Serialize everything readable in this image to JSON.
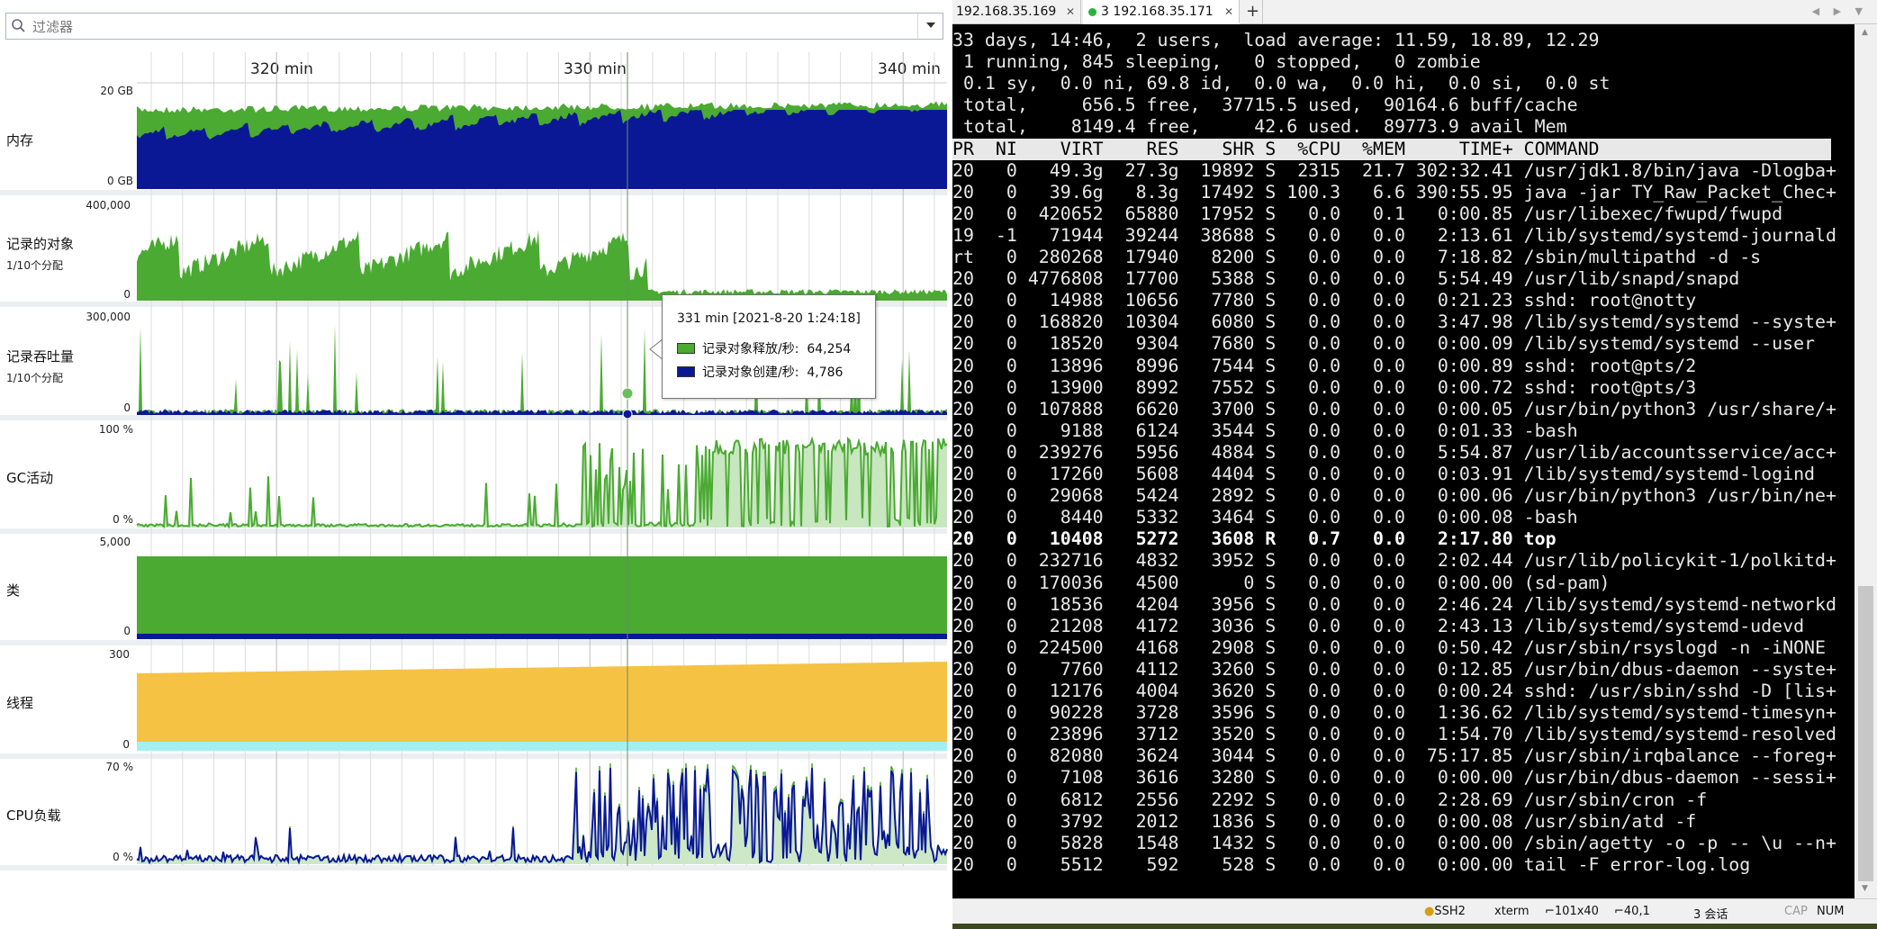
{
  "filter": {
    "placeholder": "过滤器",
    "search_icon": "search-icon",
    "dropdown_icon": "chevron-down-icon"
  },
  "timeline": {
    "labels": [
      "320 min",
      "330 min",
      "340 min"
    ],
    "cursor_label": "331 min"
  },
  "rows": {
    "memory": {
      "label": "内存",
      "y_top": "20 GB",
      "y_bottom": "0 GB"
    },
    "objects": {
      "label": "记录的对象",
      "sublabel": "1/10个分配",
      "y_top": "400,000",
      "y_bottom": "0"
    },
    "throughput": {
      "label": "记录吞吐量",
      "sublabel": "1/10个分配",
      "y_top": "300,000",
      "y_bottom": "0"
    },
    "gc": {
      "label": "GC活动",
      "y_top": "100 %",
      "y_bottom": "0 %"
    },
    "classes": {
      "label": "类",
      "y_top": "5,000",
      "y_bottom": "0"
    },
    "threads": {
      "label": "线程",
      "y_top": "300",
      "y_bottom": "0"
    },
    "cpu": {
      "label": "CPU负载",
      "y_top": "70 %",
      "y_bottom": "0 %"
    }
  },
  "tooltip": {
    "title": "331 min [2021-8-20 1:24:18]",
    "rows": [
      {
        "label": "记录对象释放/秒:",
        "value": "64,254",
        "color": "#4aaa32"
      },
      {
        "label": "记录对象创建/秒:",
        "value": "4,786",
        "color": "#0a1896"
      }
    ]
  },
  "colors": {
    "green": "#4aaa32",
    "navy": "#0a1896",
    "yellow": "#f5c244",
    "cyan": "#a3f0ee"
  },
  "terminal": {
    "tabs": [
      {
        "label": "192.168.35.169"
      },
      {
        "label": "3 192.168.35.171"
      }
    ],
    "tab_add": "+",
    "tab_nav": "◀ ▶ ▼",
    "summary": [
      "33 days, 14:46,  2 users,  load average: 11.59, 18.89, 12.29",
      " 1 running, 845 sleeping,   0 stopped,   0 zombie",
      " 0.1 sy,  0.0 ni, 69.8 id,  0.0 wa,  0.0 hi,  0.0 si,  0.0 st",
      " total,     656.5 free,  37715.5 used,  90164.6 buff/cache",
      " total,    8149.4 free,     42.6 used.  89773.9 avail Mem"
    ],
    "header": "PR  NI    VIRT    RES    SHR S  %CPU  %MEM     TIME+ COMMAND",
    "processes": [
      "20   0   49.3g  27.3g  19892 S  2315  21.7 302:32.41 /usr/jdk1.8/bin/java -Dlogba+",
      "20   0   39.6g   8.3g  17492 S 100.3   6.6 390:55.95 java -jar TY_Raw_Packet_Chec+",
      "20   0  420652  65880  17952 S   0.0   0.1   0:00.85 /usr/libexec/fwupd/fwupd",
      "19  -1   71944  39244  38688 S   0.0   0.0   2:13.61 /lib/systemd/systemd-journald",
      "rt   0  280268  17940   8200 S   0.0   0.0   7:18.82 /sbin/multipathd -d -s",
      "20   0 4776808  17700   5388 S   0.0   0.0   5:54.49 /usr/lib/snapd/snapd",
      "20   0   14988  10656   7780 S   0.0   0.0   0:21.23 sshd: root@notty",
      "20   0  168820  10304   6080 S   0.0   0.0   3:47.98 /lib/systemd/systemd --syste+",
      "20   0   18520   9304   7680 S   0.0   0.0   0:00.09 /lib/systemd/systemd --user",
      "20   0   13896   8996   7544 S   0.0   0.0   0:00.89 sshd: root@pts/2",
      "20   0   13900   8992   7552 S   0.0   0.0   0:00.72 sshd: root@pts/3",
      "20   0  107888   6620   3700 S   0.0   0.0   0:00.05 /usr/bin/python3 /usr/share/+",
      "20   0    9188   6124   3544 S   0.0   0.0   0:01.33 -bash",
      "20   0  239276   5956   4884 S   0.0   0.0   5:54.87 /usr/lib/accountsservice/acc+",
      "20   0   17260   5608   4404 S   0.0   0.0   0:03.91 /lib/systemd/systemd-logind",
      "20   0   29068   5424   2892 S   0.0   0.0   0:00.06 /usr/bin/python3 /usr/bin/ne+",
      "20   0    8440   5332   3464 S   0.0   0.0   0:00.08 -bash",
      "20   0   10408   5272   3608 R   0.7   0.0   2:17.80 top",
      "20   0  232716   4832   3952 S   0.0   0.0   2:02.44 /usr/lib/policykit-1/polkitd+",
      "20   0  170036   4500      0 S   0.0   0.0   0:00.00 (sd-pam)",
      "20   0   18536   4204   3956 S   0.0   0.0   2:46.24 /lib/systemd/systemd-networkd",
      "20   0   21208   4172   3036 S   0.0   0.0   2:43.13 /lib/systemd/systemd-udevd",
      "20   0  224500   4168   2908 S   0.0   0.0   0:50.42 /usr/sbin/rsyslogd -n -iNONE",
      "20   0    7760   4112   3260 S   0.0   0.0   0:12.85 /usr/bin/dbus-daemon --syste+",
      "20   0   12176   4004   3620 S   0.0   0.0   0:00.24 sshd: /usr/sbin/sshd -D [lis+",
      "20   0   90228   3728   3596 S   0.0   0.0   1:36.62 /lib/systemd/systemd-timesyn+",
      "20   0   23896   3712   3520 S   0.0   0.0   1:54.70 /lib/systemd/systemd-resolved",
      "20   0   82080   3624   3044 S   0.0   0.0  75:17.85 /usr/sbin/irqbalance --foreg+",
      "20   0    7108   3616   3280 S   0.0   0.0   0:00.00 /usr/bin/dbus-daemon --sessi+",
      "20   0    6812   2556   2292 S   0.0   0.0   2:28.69 /usr/sbin/cron -f",
      "20   0    3792   2012   1836 S   0.0   0.0   0:00.08 /usr/sbin/atd -f",
      "20   0    5828   1548   1432 S   0.0   0.0   0:00.00 /sbin/agetty -o -p -- \\u --n+",
      "20   0    5512    592    528 S   0.0   0.0   0:00.00 tail -F error-log.log"
    ],
    "bold_row_index": 17
  },
  "statusbar": {
    "ssh": "SSH2",
    "term": "xterm",
    "size": "101x40",
    "pos": "40,1",
    "sessions": "3 会话",
    "cap": "CAP",
    "num": "NUM"
  }
}
